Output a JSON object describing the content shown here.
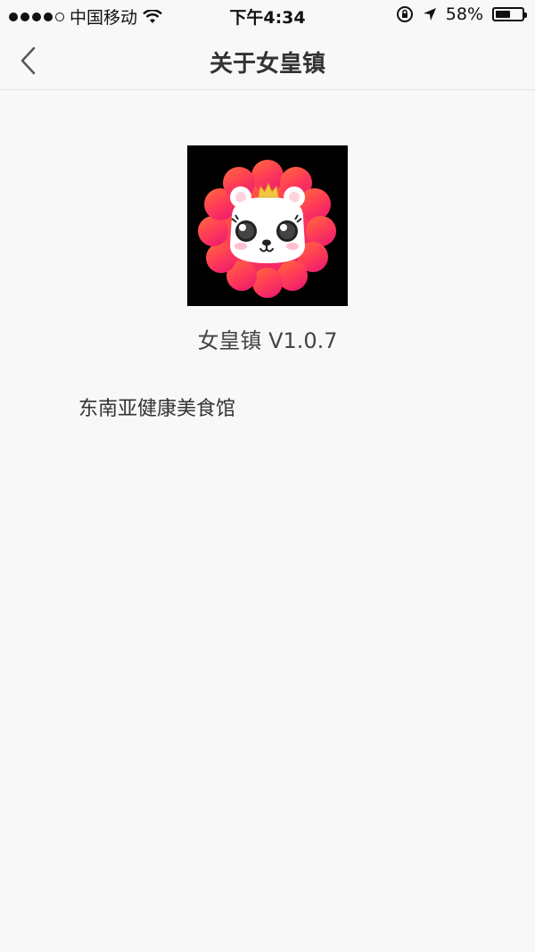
{
  "status_bar": {
    "carrier": "中国移动",
    "time": "下午4:34",
    "battery": "58%",
    "battery_level": 0.58
  },
  "nav": {
    "title": "关于女皇镇",
    "back_icon": "chevron-left-icon"
  },
  "app": {
    "logo_icon": "lion-queen-logo",
    "version": "女皇镇 V1.0.7",
    "description": "东南亚健康美食馆"
  },
  "colors": {
    "background": "#f8f8f8",
    "logo_gradient_top": "#ff5a3c",
    "logo_gradient_bottom": "#f0206a",
    "crown": "#f5c542"
  }
}
